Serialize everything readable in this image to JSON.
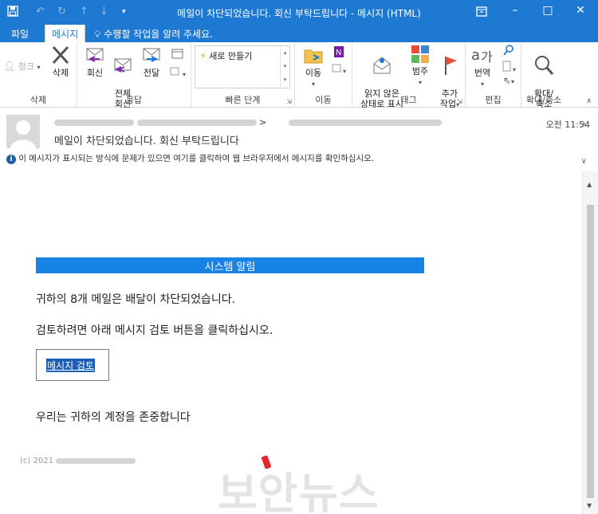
{
  "window": {
    "title": "메일이 차단되었습니다. 회신 부탁드립니다 - 메시지 (HTML)",
    "quick_access": {
      "save_icon": "save-icon",
      "undo_icon": "undo-icon",
      "redo_icon": "redo-icon",
      "up_icon": "arrow-up-icon",
      "down_icon": "arrow-down-icon",
      "customize_icon": "customize-icon"
    }
  },
  "tabs": [
    {
      "label": "파일",
      "active": false
    },
    {
      "label": "메시지",
      "active": true
    }
  ],
  "tell_me": "수행할 작업을 알려 주세요.",
  "ribbon": {
    "groups": [
      {
        "label": "삭제",
        "buttons": [
          {
            "label": "정크",
            "disabled": true,
            "icon": "junk-icon"
          },
          {
            "label": "삭제",
            "icon": "delete-icon"
          }
        ]
      },
      {
        "label": "응답",
        "buttons": [
          {
            "label": "회신",
            "icon": "reply-icon"
          },
          {
            "label": "전체\n회신",
            "icon": "reply-all-icon"
          },
          {
            "label": "전달",
            "icon": "forward-icon"
          }
        ]
      },
      {
        "label": "빠른 단계",
        "quick_step": "새로 만들기"
      },
      {
        "label": "이동",
        "buttons": [
          {
            "label": "이동",
            "icon": "move-icon"
          }
        ]
      },
      {
        "label": "태그",
        "buttons": [
          {
            "label": "읽지 않은\n상태로 표시",
            "icon": "mark-unread-icon"
          },
          {
            "label": "범주",
            "icon": "categorize-icon"
          },
          {
            "label": "추가\n작업",
            "icon": "flag-icon"
          }
        ]
      },
      {
        "label": "편집",
        "buttons": [
          {
            "label": "번역",
            "icon": "translate-icon"
          }
        ]
      },
      {
        "label": "확대/축소",
        "buttons": [
          {
            "label": "확대/\n축소",
            "icon": "zoom-icon"
          }
        ]
      }
    ]
  },
  "message": {
    "from_suffix": ">",
    "time": "오전 11:54",
    "subject": "메일이 차단되었습니다. 회신 부탁드립니다",
    "info": "이 메시지가 표시되는 방식에 문제가 있으면 여기를 클릭하여 웹 브라우저에서 메시지를 확인하십시오."
  },
  "body": {
    "alert_title": "시스템 알림",
    "line1": "귀하의 8개 메일은 배달이 차단되었습니다.",
    "line2": "검토하려면 아래 메시지 검토 버튼을 클릭하십시오.",
    "button": "메시지 검토",
    "line3": "우리는 귀하의 계정을 존중합니다",
    "footer": "(c) 2021"
  },
  "watermark": "보안뉴스",
  "colors": {
    "titlebar": "#1e79d2",
    "alert_bar": "#1883e6",
    "link_bg": "#1b5fb6",
    "watermark_dot": "#e5252a"
  }
}
